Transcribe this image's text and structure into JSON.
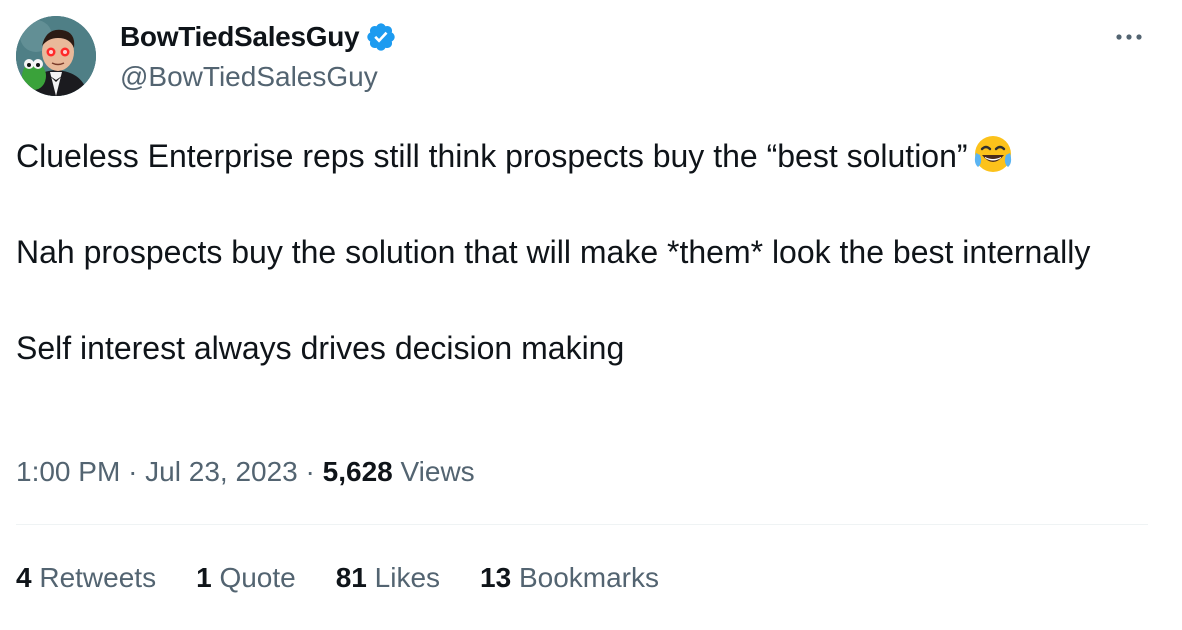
{
  "author": {
    "display_name": "BowTiedSalesGuy",
    "handle": "@BowTiedSalesGuy",
    "verified_color": "#1d9bf0"
  },
  "tweet": {
    "paragraphs": [
      "Clueless Enterprise reps still think prospects buy the “best solution”",
      "Nah prospects buy the solution that will make *them* look the best internally",
      "Self interest always drives decision making"
    ],
    "emoji": "face-with-tears-of-joy"
  },
  "meta": {
    "time": "1:00 PM",
    "separator": "·",
    "date": "Jul 23, 2023",
    "views_count": "5,628",
    "views_label": "Views"
  },
  "stats": {
    "retweets_count": "4",
    "retweets_label": "Retweets",
    "quotes_count": "1",
    "quotes_label": "Quote",
    "likes_count": "81",
    "likes_label": "Likes",
    "bookmarks_count": "13",
    "bookmarks_label": "Bookmarks"
  },
  "icons": {
    "more": "more-dots-icon",
    "verified": "verified-badge-icon"
  }
}
